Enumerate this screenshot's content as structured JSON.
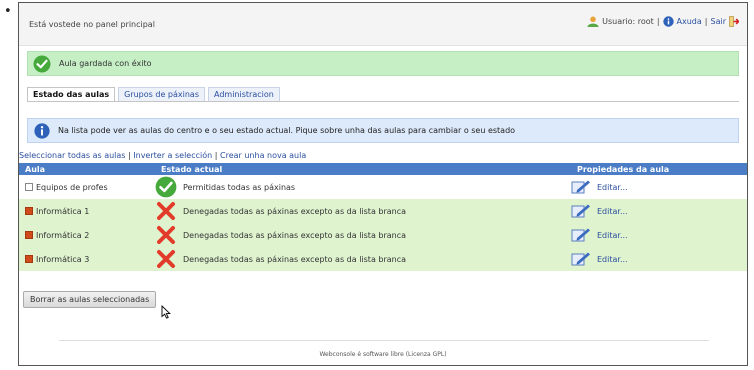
{
  "bullet": "•",
  "header": {
    "welcome": "Está vostede no panel principal",
    "user_label": "Usuario: root",
    "help_label": "Axuda",
    "exit_label": "Sair",
    "sep": "|"
  },
  "success_message": "Aula gardada con éxito",
  "tabs": [
    {
      "label": "Estado das aulas",
      "active": true
    },
    {
      "label": "Grupos de páxinas",
      "active": false
    },
    {
      "label": "Administracion",
      "active": false
    }
  ],
  "info_message": "Na lista pode ver as aulas do centro e o seu estado actual. Pique sobre unha das aulas para cambiar o seu estado",
  "actions": {
    "select_all": "Seleccionar todas as aulas",
    "invert": "Inverter a selección",
    "new": "Crear unha nova aula",
    "sep": "|"
  },
  "table": {
    "headers": [
      "Aula",
      "Estado actual",
      "Propiedades da aula"
    ],
    "rows": [
      {
        "name": "Equipos de profes",
        "checked": false,
        "status_icon": "check-circle-icon",
        "status": "Permitidas todas as páxinas",
        "edit": "Editar..."
      },
      {
        "name": "Informática 1",
        "checked": true,
        "status_icon": "red-x-icon",
        "status": "Denegadas todas as páxinas excepto as da lista branca",
        "edit": "Editar..."
      },
      {
        "name": "Informática 2",
        "checked": true,
        "status_icon": "red-x-icon",
        "status": "Denegadas todas as páxinas excepto as da lista branca",
        "edit": "Editar..."
      },
      {
        "name": "Informática 3",
        "checked": true,
        "status_icon": "red-x-icon",
        "status": "Denegadas todas as páxinas excepto as da lista branca",
        "edit": "Editar..."
      }
    ]
  },
  "delete_button": "Borrar as aulas seleccionadas",
  "footer": "Webconsole é software libre (Licenza GPL)",
  "colors": {
    "success_bg": "#c6efc6",
    "info_bg": "#ddeafb",
    "table_header": "#4b7cc6",
    "selected_row": "#dff3cf",
    "link": "#2a4f9e"
  }
}
